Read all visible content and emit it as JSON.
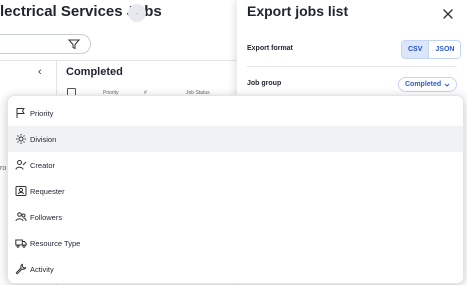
{
  "background": {
    "title": "lectrical Services Jobs",
    "title_badge": "·",
    "sidebar_toggle": "‹",
    "section_title": "Completed",
    "columns": [
      "Priority",
      "#",
      "Job Status"
    ],
    "cut_label": "ro"
  },
  "panel": {
    "title": "Export jobs list",
    "format_label": "Export format",
    "formats": [
      "CSV",
      "JSON"
    ],
    "selected_format": "CSV",
    "group_label": "Job group",
    "group_value": "Completed"
  },
  "menu": {
    "items": [
      {
        "label": "Priority",
        "icon": "flag-icon",
        "highlighted": false
      },
      {
        "label": "Division",
        "icon": "gear-icon",
        "highlighted": true
      },
      {
        "label": "Creator",
        "icon": "user-pen-icon",
        "highlighted": false
      },
      {
        "label": "Requester",
        "icon": "id-card-icon",
        "highlighted": false
      },
      {
        "label": "Followers",
        "icon": "users-icon",
        "highlighted": false
      },
      {
        "label": "Resource Type",
        "icon": "truck-icon",
        "highlighted": false
      },
      {
        "label": "Activity",
        "icon": "wrench-icon",
        "highlighted": false
      }
    ]
  },
  "colors": {
    "accent": "#2d5bc8",
    "accent_bg": "#dbe6fb",
    "highlight_row": "#f1f2f4"
  }
}
